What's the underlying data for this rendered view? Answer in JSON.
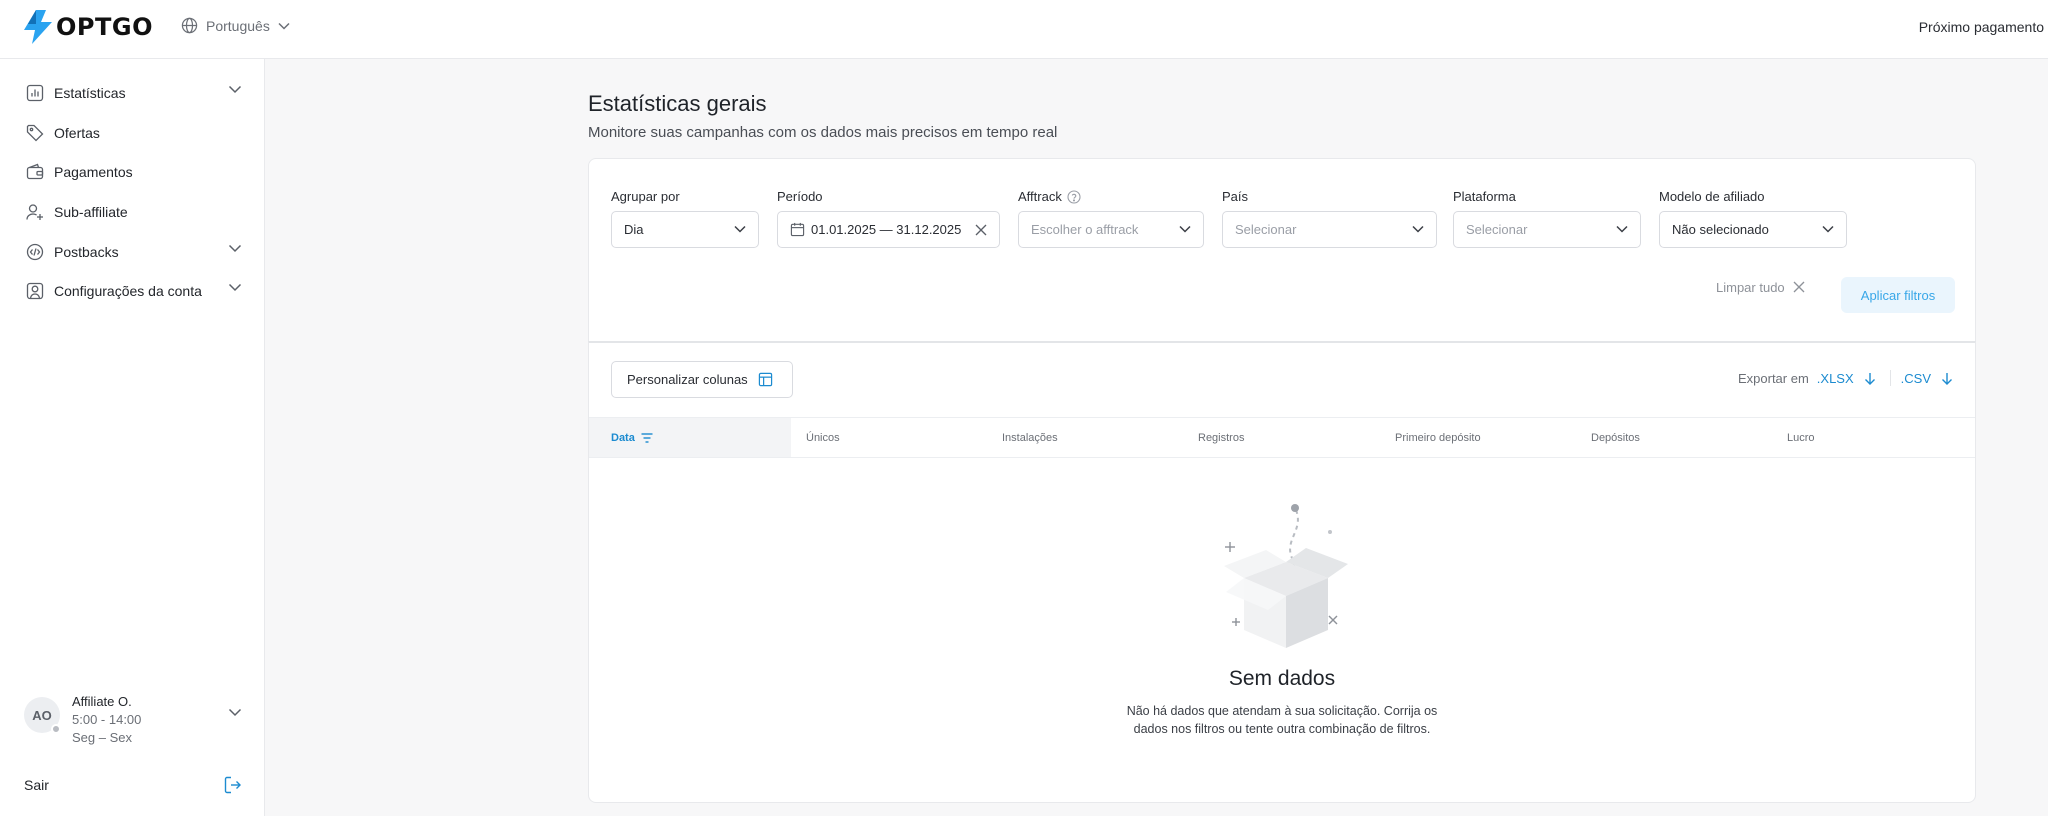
{
  "header": {
    "logo_text": "OPTGO",
    "language": "Português",
    "right_text": "Próximo pagamento"
  },
  "sidebar": {
    "items": [
      {
        "label": "Estatísticas",
        "icon": "bar-chart-icon",
        "expandable": true
      },
      {
        "label": "Ofertas",
        "icon": "tag-icon",
        "expandable": false
      },
      {
        "label": "Pagamentos",
        "icon": "wallet-icon",
        "expandable": false
      },
      {
        "label": "Sub-affiliate",
        "icon": "user-plus-icon",
        "expandable": false
      },
      {
        "label": "Postbacks",
        "icon": "code-icon",
        "expandable": true
      },
      {
        "label": "Configurações da conta",
        "icon": "account-settings-icon",
        "expandable": true
      }
    ],
    "user": {
      "initials": "AO",
      "name": "Affiliate O.",
      "hours": "5:00 - 14:00",
      "days": "Seg – Sex"
    },
    "logout_label": "Sair"
  },
  "main": {
    "title": "Estatísticas gerais",
    "subtitle": "Monitore suas campanhas com os dados mais precisos em tempo real"
  },
  "filters": {
    "group_by": {
      "label": "Agrupar por",
      "value": "Dia"
    },
    "period": {
      "label": "Período",
      "value": "01.01.2025 — 31.12.2025"
    },
    "afftrack": {
      "label": "Afftrack",
      "placeholder": "Escolher o afftrack"
    },
    "country": {
      "label": "País",
      "placeholder": "Selecionar"
    },
    "platform": {
      "label": "Plataforma",
      "placeholder": "Selecionar"
    },
    "affiliate_model": {
      "label": "Modelo de afiliado",
      "value": "Não selecionado"
    },
    "clear_label": "Limpar tudo",
    "apply_label": "Aplicar filtros"
  },
  "table": {
    "customize_label": "Personalizar colunas",
    "export_label": "Exportar em",
    "export_xlsx": ".XLSX",
    "export_csv": ".CSV",
    "columns": [
      "Data",
      "Únicos",
      "Instalações",
      "Registros",
      "Primeiro depósito",
      "Depósitos",
      "Lucro"
    ],
    "empty_title": "Sem dados",
    "empty_text": "Não há dados que atendam à sua solicitação. Corrija os dados nos filtros ou tente outra combinação de filtros."
  },
  "colors": {
    "accent": "#1c8bd0",
    "logo_blue": "#2aa3f0",
    "apply_bg": "#eaf5fd"
  }
}
